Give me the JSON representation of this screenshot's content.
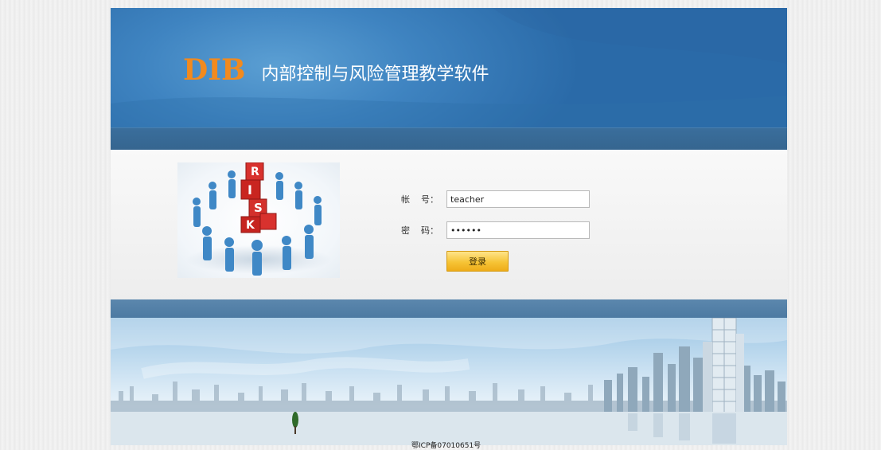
{
  "header": {
    "logo_mark": "DIB",
    "title": "内部控制与风险管理教学软件"
  },
  "login": {
    "image_caption_letters": [
      "R",
      "I",
      "S",
      "K"
    ],
    "account_label": "帐    号：",
    "account_value": "teacher",
    "password_label": "密    码：",
    "password_value": "••••••",
    "submit_label": "登录"
  },
  "footer": {
    "icp_text": "鄂ICP备07010651号"
  },
  "colors": {
    "banner": "#3f84c1",
    "logo_mark": "#f28a1e",
    "button": "#f6c436"
  }
}
